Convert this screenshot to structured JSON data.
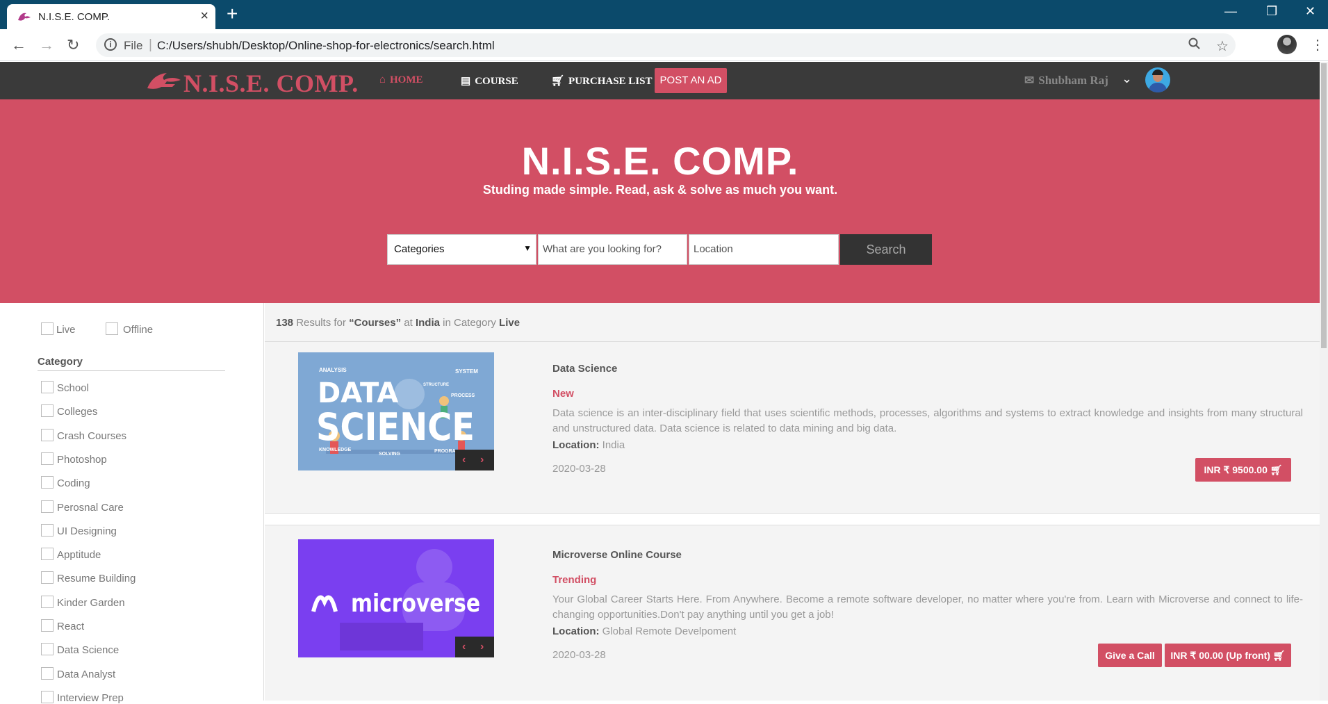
{
  "browser": {
    "tab_title": "N.I.S.E. COMP.",
    "new_tab": "+",
    "close_tab": "×",
    "file_label": "File",
    "url": "C:/Users/shubh/Desktop/Online-shop-for-electronics/search.html",
    "controls": {
      "minimize": "—",
      "restore": "❐",
      "close": "✕"
    }
  },
  "navbar": {
    "logo_text": "N.I.S.E. COMP.",
    "items": [
      {
        "label": "HOME",
        "icon": "home-icon"
      },
      {
        "label": "COURSE",
        "icon": "list-icon"
      },
      {
        "label": "PURCHASE LIST",
        "icon": "cart-icon"
      }
    ],
    "post_ad": "POST AN AD",
    "user_name": "Shubham Raj"
  },
  "hero": {
    "title": "N.I.S.E. COMP.",
    "subtitle": "Studing made simple. Read, ask & solve as much you want.",
    "category_select": "Categories",
    "keyword_placeholder": "What are you looking for?",
    "location_placeholder": "Location",
    "search_label": "Search"
  },
  "sidebar": {
    "mode_filters": [
      "Live",
      "Offline"
    ],
    "category_heading": "Category",
    "categories": [
      "School",
      "Colleges",
      "Crash Courses",
      "Photoshop",
      "Coding",
      "Perosnal Care",
      "UI Designing",
      "Apptitude",
      "Resume Building",
      "Kinder Garden",
      "React",
      "Data Science",
      "Data Analyst",
      "Interview Prep"
    ]
  },
  "results": {
    "count": "138",
    "text_results_for": "Results for",
    "query": "“Courses”",
    "text_at": "at",
    "place": "India",
    "text_in_category": "in Category",
    "category": "Live",
    "location_label": "Location:",
    "items": [
      {
        "title": "Data Science",
        "badge": "New",
        "description": "Data science is an inter-disciplinary field that uses scientific methods, processes, algorithms and systems to extract knowledge and insights from many structural and unstructured data. Data science is related to data mining and big data.",
        "location": "India",
        "date": "2020-03-28",
        "price": "INR ₹ 9500.00"
      },
      {
        "title": "Microverse Online Course",
        "badge": "Trending",
        "description": "Your Global Career Starts Here. From Anywhere. Become a remote software developer, no matter where you're from. Learn with Microverse and connect to life-changing opportunities.Don't pay anything until you get a job!",
        "location": "Global Remote Develpoment",
        "date": "2020-03-28",
        "call_label": "Give a Call",
        "price": "INR ₹ 00.00 (Up front)"
      }
    ]
  },
  "thumb1": {
    "line1": "DATA",
    "line2": "SCIENCE",
    "tags": [
      "ANALYSIS",
      "SYSTEM",
      "STRUCTURE",
      "PROCESS",
      "KNOWLEDGE",
      "SOLVING",
      "PROGRA"
    ]
  },
  "thumb2": {
    "brand": "microverse"
  },
  "colors": {
    "accent": "#d24f64",
    "navbar": "#3a3a3a",
    "tabbar": "#0b4a6b"
  }
}
